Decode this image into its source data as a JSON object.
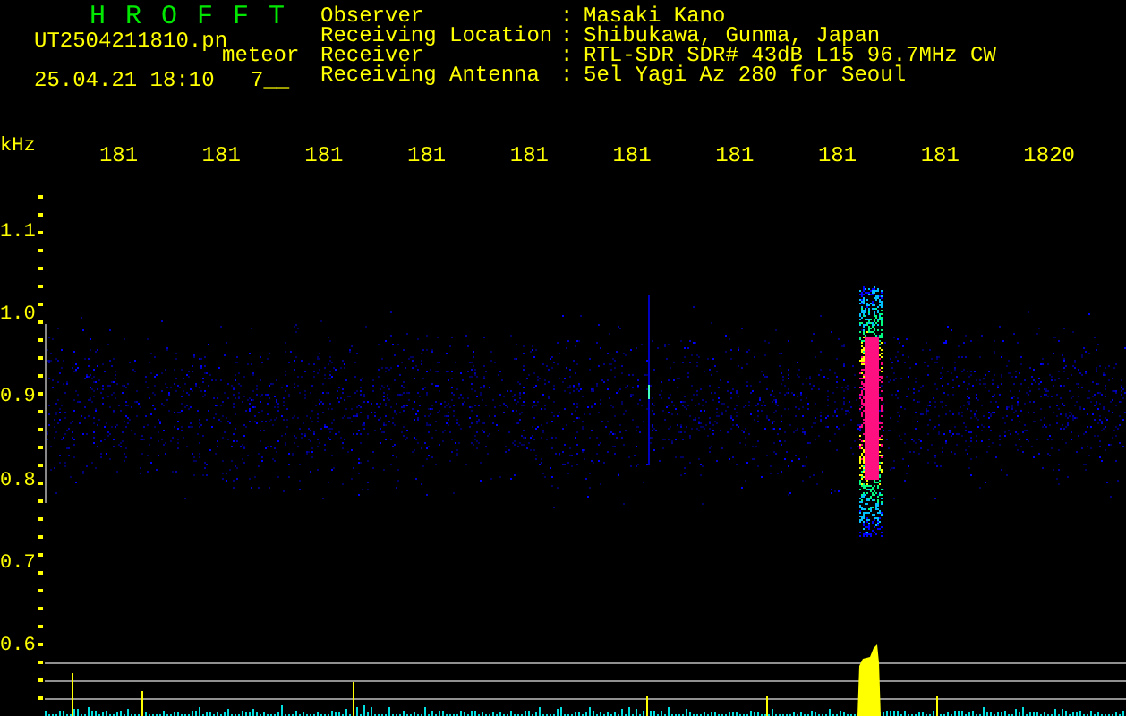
{
  "header": {
    "title": "H R O F F T",
    "filename": "UT2504211810.pn",
    "tag": "meteor",
    "timestamp": "25.04.21 18:10",
    "count": "7__"
  },
  "info": [
    {
      "label": "Observer",
      "separator": ":",
      "value": "Masaki Kano"
    },
    {
      "label": "Receiving Location",
      "separator": ":",
      "value": "Shibukawa, Gunma, Japan"
    },
    {
      "label": "Receiver",
      "separator": ":",
      "value": "RTL-SDR SDR# 43dB L15 96.7MHz CW"
    },
    {
      "label": "Receiving Antenna",
      "separator": ":",
      "value": "5el Yagi Az 280 for Seoul"
    }
  ],
  "x_axis": {
    "labels": [
      "181",
      "181",
      "181",
      "181",
      "181",
      "181",
      "181",
      "181",
      "181",
      "1820"
    ]
  },
  "y_axis": {
    "unit": "kHz",
    "labels": [
      "1.1",
      "1.0",
      "0.9",
      "0.8",
      "0.7",
      "0.6"
    ]
  }
}
